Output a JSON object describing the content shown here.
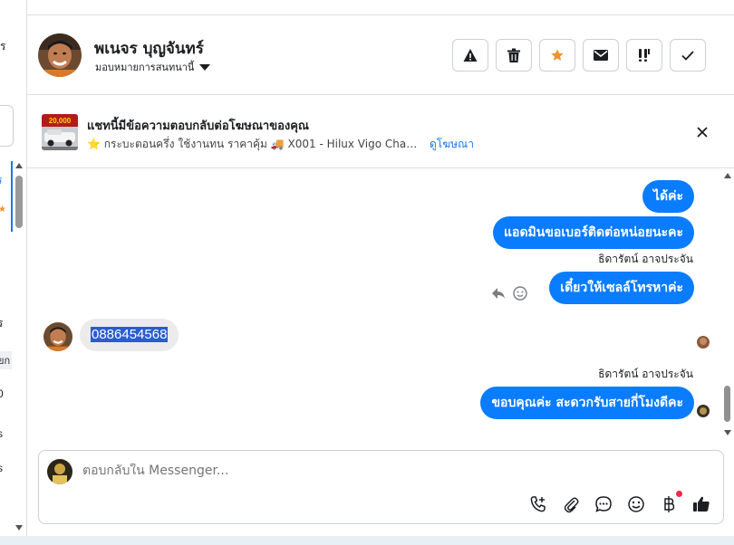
{
  "sidebar_fragments": {
    "top": "ร",
    "mid_a": "ร",
    "mid_b": "ยก",
    "mid_c": "0",
    "mid_d": "s",
    "mid_e": "s"
  },
  "contact": {
    "name": "พเนจร บุญจันทร์",
    "assign_label": "มอบหมายการสนทนานี้"
  },
  "header_actions": [
    {
      "name": "spam-button",
      "icon": "warning-icon"
    },
    {
      "name": "delete-button",
      "icon": "trash-icon"
    },
    {
      "name": "star-button",
      "icon": "star-icon"
    },
    {
      "name": "mark-unread-button",
      "icon": "envelope-icon"
    },
    {
      "name": "follow-up-button",
      "icon": "flag-icon"
    },
    {
      "name": "done-button",
      "icon": "check-icon"
    }
  ],
  "ad_banner": {
    "title": "แชทนี้มีข้อความตอบกลับต่อโฆษณาของคุณ",
    "description": "⭐ กระบะตอนครึ่ง ใช้งานทน ราคาคุ้ม 🚚 X001 - Hilux Vigo Champ Ca...",
    "link": "ดูโฆษณา",
    "thumb_price": "20,000"
  },
  "messages": [
    {
      "id": "m1",
      "direction": "out",
      "text": "ได้ค่ะ"
    },
    {
      "id": "m2",
      "direction": "out",
      "text": "แอดมินขอเบอร์ติดต่อหน่อยนะคะ"
    },
    {
      "id": "m3",
      "direction": "out",
      "sender": "ธิดารัตน์ อาจประจัน",
      "text": "เดี๋ยวให้เซลล์โทรหาค่ะ"
    },
    {
      "id": "m4",
      "direction": "in",
      "text": "0886454568"
    },
    {
      "id": "m5",
      "direction": "out",
      "sender": "ธิดารัตน์ อาจประจัน",
      "text": "ขอบคุณค่ะ สะดวกรับสายกี่โมงดีคะ"
    }
  ],
  "composer": {
    "placeholder": "ตอบกลับใน Messenger...",
    "tools": [
      "call-add-icon",
      "paperclip-icon",
      "chat-bubble-icon",
      "emoji-icon",
      "baht-icon",
      "thumbs-up-icon"
    ]
  },
  "colors": {
    "accent": "#0a7cff",
    "link": "#1877f2",
    "star": "#f0932b",
    "notification": "#f02849"
  }
}
